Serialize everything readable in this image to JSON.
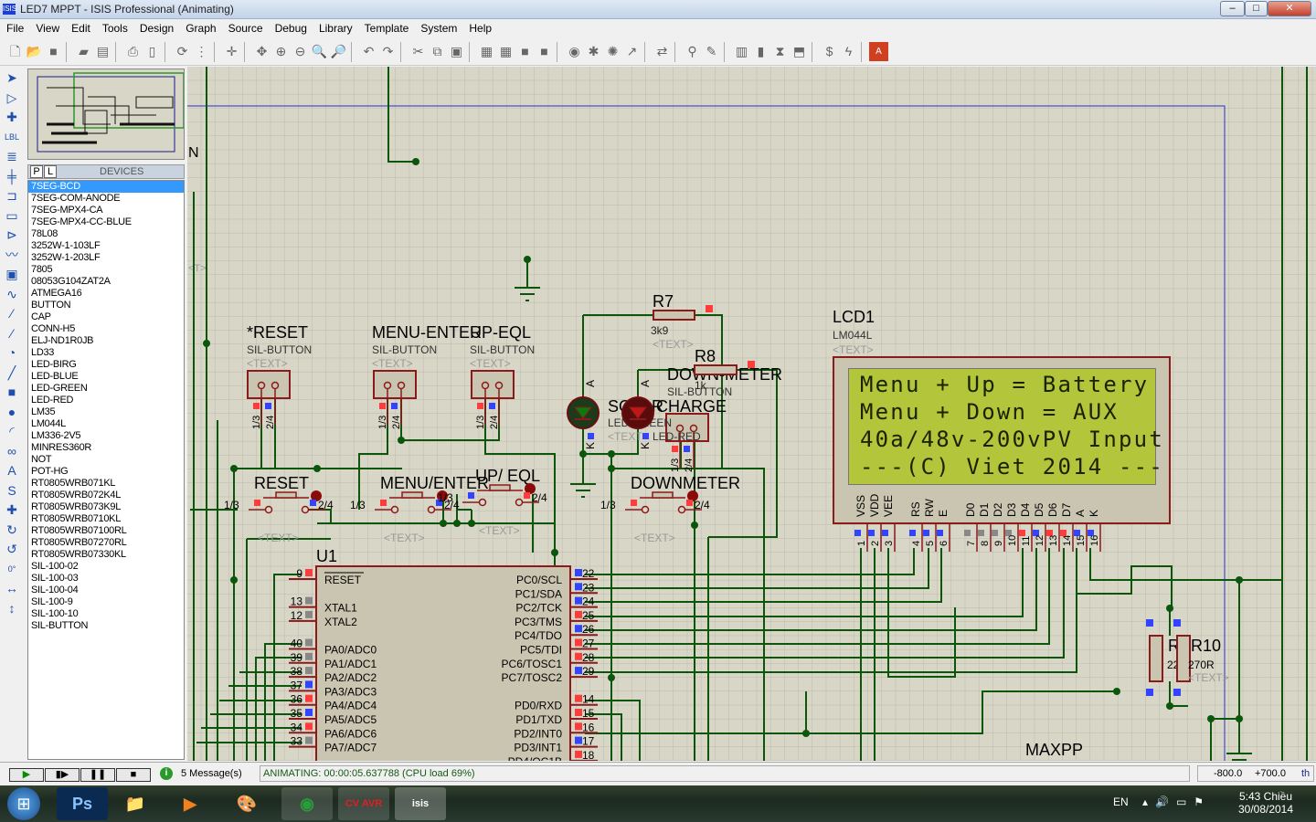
{
  "window": {
    "title": "LED7 MPPT - ISIS Professional (Animating)",
    "app_icon": "ISIS",
    "minimize": "–",
    "maximize": "□",
    "close": "✕"
  },
  "menu": [
    "File",
    "View",
    "Edit",
    "Tools",
    "Design",
    "Graph",
    "Source",
    "Debug",
    "Library",
    "Template",
    "System",
    "Help"
  ],
  "toolbar": [
    {
      "n": "new-icon",
      "g": "🗋"
    },
    {
      "n": "open-icon",
      "g": "📂"
    },
    {
      "n": "save-icon",
      "g": "■"
    },
    {
      "n": "sep"
    },
    {
      "n": "import-icon",
      "g": "▰"
    },
    {
      "n": "export-icon",
      "g": "▤"
    },
    {
      "n": "sep"
    },
    {
      "n": "print-icon",
      "g": "⎙"
    },
    {
      "n": "print-area-icon",
      "g": "▯"
    },
    {
      "n": "sep"
    },
    {
      "n": "refresh-icon",
      "g": "⟳"
    },
    {
      "n": "grid-icon",
      "g": "⋮"
    },
    {
      "n": "sep"
    },
    {
      "n": "origin-icon",
      "g": "✛"
    },
    {
      "n": "sep"
    },
    {
      "n": "pan-icon",
      "g": "✥"
    },
    {
      "n": "zoom-in-icon",
      "g": "⊕"
    },
    {
      "n": "zoom-out-icon",
      "g": "⊖"
    },
    {
      "n": "zoom-all-icon",
      "g": "🔍"
    },
    {
      "n": "zoom-area-icon",
      "g": "🔎"
    },
    {
      "n": "sep"
    },
    {
      "n": "undo-icon",
      "g": "↶"
    },
    {
      "n": "redo-icon",
      "g": "↷"
    },
    {
      "n": "sep"
    },
    {
      "n": "cut-icon",
      "g": "✂"
    },
    {
      "n": "copy-icon",
      "g": "⧉"
    },
    {
      "n": "paste-icon",
      "g": "▣"
    },
    {
      "n": "sep"
    },
    {
      "n": "block-copy-icon",
      "g": "▦"
    },
    {
      "n": "block-move-icon",
      "g": "▦"
    },
    {
      "n": "block-rotate-icon",
      "g": "■"
    },
    {
      "n": "block-delete-icon",
      "g": "■"
    },
    {
      "n": "sep"
    },
    {
      "n": "pick-device-icon",
      "g": "◉"
    },
    {
      "n": "make-device-icon",
      "g": "✱"
    },
    {
      "n": "package-tool-icon",
      "g": "✺"
    },
    {
      "n": "decompose-icon",
      "g": "↗"
    },
    {
      "n": "sep"
    },
    {
      "n": "wire-autorouter-icon",
      "g": "⇄"
    },
    {
      "n": "sep"
    },
    {
      "n": "search-icon",
      "g": "⚲"
    },
    {
      "n": "property-tool-icon",
      "g": "✎"
    },
    {
      "n": "sep"
    },
    {
      "n": "new-sheet-icon",
      "g": "▥"
    },
    {
      "n": "remove-sheet-icon",
      "g": "▮"
    },
    {
      "n": "goto-sheet-icon",
      "g": "⧗"
    },
    {
      "n": "export-section-icon",
      "g": "⬒"
    },
    {
      "n": "sep"
    },
    {
      "n": "bill-of-materials-icon",
      "g": "$"
    },
    {
      "n": "electrical-rule-check-icon",
      "g": "ϟ"
    },
    {
      "n": "sep"
    },
    {
      "n": "ares-icon",
      "g": "A"
    }
  ],
  "left_tools": [
    {
      "n": "selection-mode-icon",
      "g": "➤"
    },
    {
      "n": "component-mode-icon",
      "g": "▷"
    },
    {
      "n": "junction-dot-icon",
      "g": "✚"
    },
    {
      "n": "wire-label-icon",
      "g": "LBL"
    },
    {
      "n": "text-script-icon",
      "g": "≣"
    },
    {
      "n": "buses-icon",
      "g": "╪"
    },
    {
      "n": "subcircuit-icon",
      "g": "⊐"
    },
    {
      "n": "terminals-icon",
      "g": "▭"
    },
    {
      "n": "device-pins-icon",
      "g": "⊳"
    },
    {
      "n": "graph-mode-icon",
      "g": "〰"
    },
    {
      "n": "tape-recorder-icon",
      "g": "▣"
    },
    {
      "n": "generator-icon",
      "g": "∿"
    },
    {
      "n": "voltage-probe-icon",
      "g": "⁄"
    },
    {
      "n": "current-probe-icon",
      "g": "⁄"
    },
    {
      "n": "virtual-instruments-icon",
      "g": "◔"
    },
    {
      "n": "line-icon",
      "g": "╱"
    },
    {
      "n": "box-icon",
      "g": "■"
    },
    {
      "n": "circle-icon",
      "g": "●"
    },
    {
      "n": "arc-icon",
      "g": "◜"
    },
    {
      "n": "path-icon",
      "g": "∞"
    },
    {
      "n": "text-icon",
      "g": "A"
    },
    {
      "n": "symbol-icon",
      "g": "S"
    },
    {
      "n": "marker-icon",
      "g": "✚"
    },
    {
      "n": "rotate-clockwise-icon",
      "g": "↻"
    },
    {
      "n": "rotate-anticlockwise-icon",
      "g": "↺"
    },
    {
      "n": "rotation-angle-field",
      "g": "0°"
    },
    {
      "n": "mirror-horizontal-icon",
      "g": "↔"
    },
    {
      "n": "mirror-vertical-icon",
      "g": "↕"
    }
  ],
  "devices": {
    "p": "P",
    "l": "L",
    "header": "DEVICES",
    "selected": "7SEG-BCD",
    "items": [
      "7SEG-BCD",
      "7SEG-COM-ANODE",
      "7SEG-MPX4-CA",
      "7SEG-MPX4-CC-BLUE",
      "78L08",
      "3252W-1-103LF",
      "3252W-1-203LF",
      "7805",
      "08053G104ZAT2A",
      "ATMEGA16",
      "BUTTON",
      "CAP",
      "CONN-H5",
      "ELJ-ND1R0JB",
      "LD33",
      "LED-BIRG",
      "LED-BLUE",
      "LED-GREEN",
      "LED-RED",
      "LM35",
      "LM044L",
      "LM336-2V5",
      "MINRES360R",
      "NOT",
      "POT-HG",
      "RT0805WRB071KL",
      "RT0805WRB072K4L",
      "RT0805WRB073K9L",
      "RT0805WRB0710KL",
      "RT0805WRB07100RL",
      "RT0805WRB07270RL",
      "RT0805WRB07330KL",
      "SIL-100-02",
      "SIL-100-03",
      "SIL-100-04",
      "SIL-100-9",
      "SIL-100-10",
      "SIL-BUTTON"
    ]
  },
  "schematic": {
    "clip_n": "N",
    "clip_t": "<T>",
    "text_placeholder": "<TEXT>",
    "sil_buttons": [
      {
        "ref": "*RESET",
        "part": "SIL-BUTTON"
      },
      {
        "ref": "MENU-ENTER",
        "part": "SIL-BUTTON"
      },
      {
        "ref": "UP-EQL",
        "part": "SIL-BUTTON"
      },
      {
        "ref": "DOWN-METER",
        "part": "SIL-BUTTON"
      }
    ],
    "pin_13": "1/3",
    "pin_24": "2/4",
    "push_buttons": [
      "RESET",
      "MENU/ENTER",
      "UP/ EQL",
      "DOWNMETER"
    ],
    "r7": {
      "ref": "R7",
      "value": "3k9"
    },
    "r8": {
      "ref": "R8",
      "value": "1k"
    },
    "leds": [
      {
        "ref": "SOLAR",
        "part": "LED-GREEN"
      },
      {
        "ref": "CHARGE",
        "part": "LED-RED"
      }
    ],
    "led_pin_a": "A",
    "led_pin_k": "K",
    "r4": {
      "ref": "R4",
      "value": "22R"
    },
    "r10": {
      "ref": "R10",
      "value": "270R"
    },
    "maxpp": "MAXPP",
    "lcd": {
      "ref": "LCD1",
      "part": "LM044L",
      "lines": [
        "Menu + Up = Battery",
        "Menu + Down = AUX",
        "40a/48v-200vPV Input",
        "---(C) Viet 2014 ---"
      ],
      "pins": [
        {
          "l": "VSS",
          "n": "1",
          "s": "b"
        },
        {
          "l": "VDD",
          "n": "2",
          "s": "b"
        },
        {
          "l": "VEE",
          "n": "3",
          "s": "b"
        },
        {
          "l": "RS",
          "n": "4",
          "s": "b"
        },
        {
          "l": "RW",
          "n": "5",
          "s": "b"
        },
        {
          "l": "E",
          "n": "6",
          "s": "b"
        },
        {
          "l": "D0",
          "n": "7",
          "s": "g"
        },
        {
          "l": "D1",
          "n": "8",
          "s": "g"
        },
        {
          "l": "D2",
          "n": "9",
          "s": "g"
        },
        {
          "l": "D3",
          "n": "10",
          "s": "g"
        },
        {
          "l": "D4",
          "n": "11",
          "s": "r"
        },
        {
          "l": "D5",
          "n": "12",
          "s": "b"
        },
        {
          "l": "D6",
          "n": "13",
          "s": "r"
        },
        {
          "l": "D7",
          "n": "14",
          "s": "r"
        },
        {
          "l": "A",
          "n": "15",
          "s": "b"
        },
        {
          "l": "K",
          "n": "16",
          "s": "b"
        }
      ]
    },
    "u1": {
      "ref": "U1",
      "left": [
        {
          "n": "9",
          "l": "RESET",
          "s": "r",
          "row": 0
        },
        {
          "n": "13",
          "l": "XTAL1",
          "s": "g",
          "row": 2
        },
        {
          "n": "12",
          "l": "XTAL2",
          "s": "g",
          "row": 3
        },
        {
          "n": "40",
          "l": "PA0/ADC0",
          "s": "g",
          "row": 5
        },
        {
          "n": "39",
          "l": "PA1/ADC1",
          "s": "g",
          "row": 6
        },
        {
          "n": "38",
          "l": "PA2/ADC2",
          "s": "g",
          "row": 7
        },
        {
          "n": "37",
          "l": "PA3/ADC3",
          "s": "b",
          "row": 8
        },
        {
          "n": "36",
          "l": "PA4/ADC4",
          "s": "r",
          "row": 9
        },
        {
          "n": "35",
          "l": "PA5/ADC5",
          "s": "b",
          "row": 10
        },
        {
          "n": "34",
          "l": "PA6/ADC6",
          "s": "r",
          "row": 11
        },
        {
          "n": "33",
          "l": "PA7/ADC7",
          "s": "g",
          "row": 12
        }
      ],
      "right": [
        {
          "n": "22",
          "l": "PC0/SCL",
          "s": "b",
          "row": 0
        },
        {
          "n": "23",
          "l": "PC1/SDA",
          "s": "b",
          "row": 1
        },
        {
          "n": "24",
          "l": "PC2/TCK",
          "s": "b",
          "row": 2
        },
        {
          "n": "25",
          "l": "PC3/TMS",
          "s": "r",
          "row": 3
        },
        {
          "n": "26",
          "l": "PC4/TDO",
          "s": "b",
          "row": 4
        },
        {
          "n": "27",
          "l": "PC5/TDI",
          "s": "r",
          "row": 5
        },
        {
          "n": "28",
          "l": "PC6/TOSC1",
          "s": "r",
          "row": 6
        },
        {
          "n": "29",
          "l": "PC7/TOSC2",
          "s": "b",
          "row": 7
        },
        {
          "n": "14",
          "l": "PD0/RXD",
          "s": "r",
          "row": 9
        },
        {
          "n": "15",
          "l": "PD1/TXD",
          "s": "r",
          "row": 10
        },
        {
          "n": "16",
          "l": "PD2/INT0",
          "s": "r",
          "row": 11
        },
        {
          "n": "17",
          "l": "PD3/INT1",
          "s": "b",
          "row": 12
        },
        {
          "n": "18",
          "l": "PD4/OC1B",
          "s": "r",
          "row": 13
        }
      ]
    }
  },
  "sim": {
    "play": "▶",
    "step": "▮▶",
    "pause": "❚❚",
    "stop": "■",
    "messages": "5 Message(s)",
    "status": "ANIMATING: 00:00:05.637788 (CPU load 69%)",
    "x": "-800.0",
    "y": "+700.0",
    "units": "th"
  },
  "taskbar": {
    "apps": [
      {
        "n": "photoshop",
        "t": "Ps",
        "bg": "#0b2a52",
        "c": "#8ac4ff"
      },
      {
        "n": "file-explorer",
        "t": "📁",
        "bg": "transparent",
        "c": "#e8c860"
      },
      {
        "n": "media-player",
        "t": "▶",
        "bg": "transparent",
        "c": "#f08020"
      },
      {
        "n": "paint",
        "t": "🎨",
        "bg": "transparent",
        "c": "#ddd"
      },
      {
        "n": "chrome",
        "t": "◉",
        "bg": "rgba(255,255,255,.15)",
        "c": "#2a9a3a"
      },
      {
        "n": "codevision-avr",
        "t": "CV AVR",
        "bg": "rgba(255,255,255,.15)",
        "c": "#e02020"
      },
      {
        "n": "isis",
        "t": "isis",
        "bg": "rgba(255,255,255,.25)",
        "c": "#fff"
      }
    ],
    "lang": "EN",
    "time": "5:43 Chiều",
    "date": "30/08/2014"
  },
  "colors": {
    "wire": "#0b560b",
    "component": "#8b1a1a",
    "body": "#c9c5b1",
    "canvas": "#d8d6c6",
    "lcd_screen": "#b3c53a",
    "pin_high": "#ff3b3b",
    "pin_low": "#3344ff",
    "pin_float": "#888888"
  }
}
